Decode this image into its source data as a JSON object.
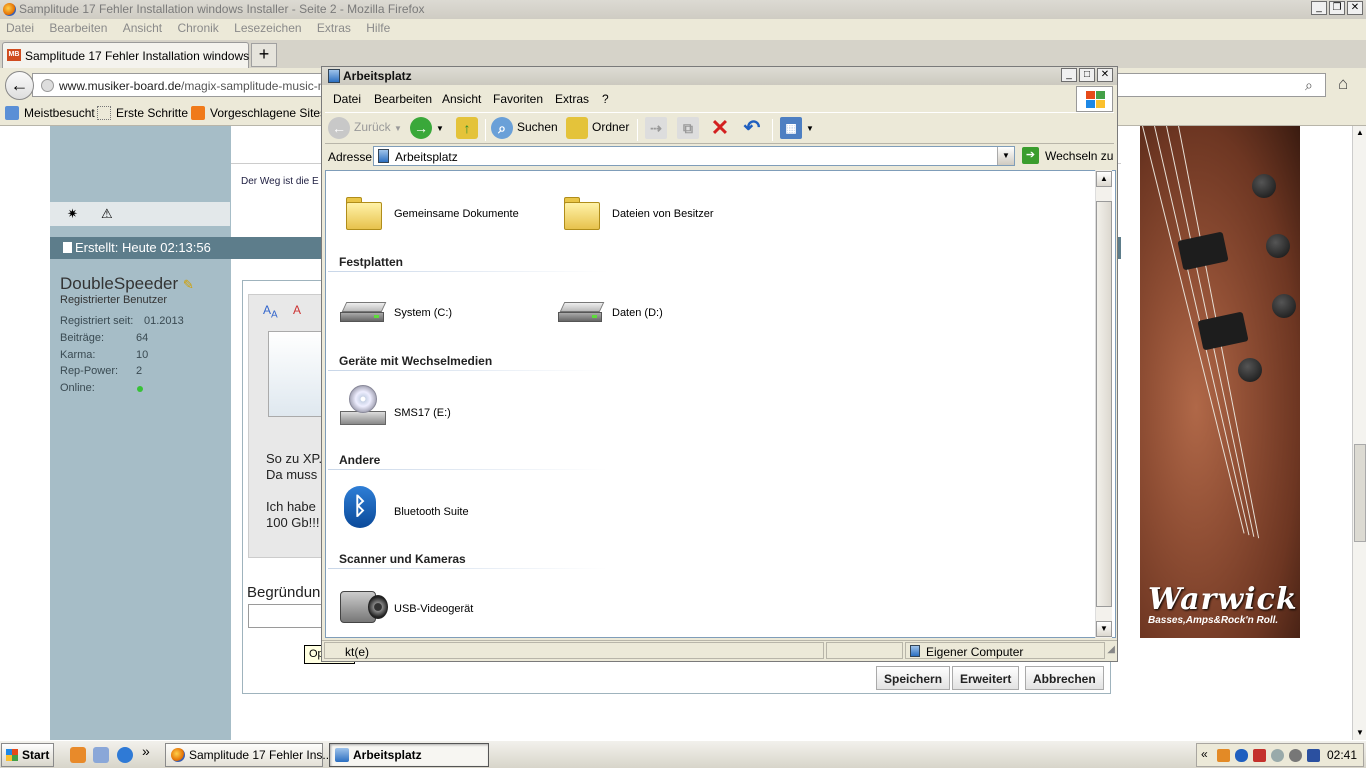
{
  "firefox": {
    "title": "Samplitude 17 Fehler Installation windows Installer - Seite 2 - Mozilla Firefox",
    "menu": [
      "Datei",
      "Bearbeiten",
      "Ansicht",
      "Chronik",
      "Lesezeichen",
      "Extras",
      "Hilfe"
    ],
    "tab_label": "Samplitude 17 Fehler Installation windows In...",
    "tab_favicon": "MB",
    "new_tab": "+",
    "url_domain": "www.musiker-board.de",
    "url_path": "/magix-samplitude-music-maker",
    "bookmarks": [
      "Meistbesucht",
      "Erste Schritte",
      "Vorgeschlagene Sites"
    ]
  },
  "webpage": {
    "slogan": "Der Weg ist die E",
    "post_header": "Erstellt: Heute 02:13:56",
    "user": {
      "name": "DoubleSpeeder",
      "role": "Registrierter Benutzer",
      "stats": [
        {
          "key": "Registriert seit:",
          "value": "01.2013"
        },
        {
          "key": "Beiträge:",
          "value": "64"
        },
        {
          "key": "Karma:",
          "value": "10"
        },
        {
          "key": "Rep-Power:",
          "value": "2"
        },
        {
          "key": "Online:",
          "value": ""
        }
      ]
    },
    "post_text": [
      "So zu XP.",
      "Da muss",
      "Ich habe",
      "100 Gb!!!"
    ],
    "reason_label": "Begründung",
    "tooltip": "Optional",
    "buttons": {
      "save": "Speichern",
      "advanced": "Erweitert",
      "cancel": "Abbrechen"
    },
    "ad": {
      "brand": "Warwick",
      "tagline": "Basses,Amps&Rock'n Roll."
    }
  },
  "explorer": {
    "title": "Arbeitsplatz",
    "menu": [
      "Datei",
      "Bearbeiten",
      "Ansicht",
      "Favoriten",
      "Extras",
      "?"
    ],
    "toolbar": {
      "back": "Zurück",
      "search": "Suchen",
      "folders": "Ordner"
    },
    "address_label": "Adresse",
    "address_value": "Arbeitsplatz",
    "go_label": "Wechseln zu",
    "groups": [
      {
        "title": "",
        "items": [
          "Gemeinsame Dokumente",
          "Dateien von Besitzer"
        ]
      },
      {
        "title": "Festplatten",
        "items": [
          "System (C:)",
          "Daten (D:)"
        ]
      },
      {
        "title": "Geräte mit Wechselmedien",
        "items": [
          "SMS17 (E:)"
        ]
      },
      {
        "title": "Andere",
        "items": [
          "Bluetooth Suite"
        ]
      },
      {
        "title": "Scanner und Kameras",
        "items": [
          "USB-Videogerät"
        ]
      }
    ],
    "status_left": "kt(e)",
    "status_right": "Eigener Computer"
  },
  "taskbar": {
    "start": "Start",
    "tasks": [
      "Samplitude 17 Fehler Ins...",
      "Arbeitsplatz"
    ],
    "chevron": "«",
    "quicklaunch_more": "»",
    "clock": "02:41"
  },
  "colors": {
    "sidebar": "#a6bdc7",
    "post_header": "#5d7d8b",
    "tooltip": "#ffffe1",
    "explorer_bg": "#ece9d8"
  }
}
